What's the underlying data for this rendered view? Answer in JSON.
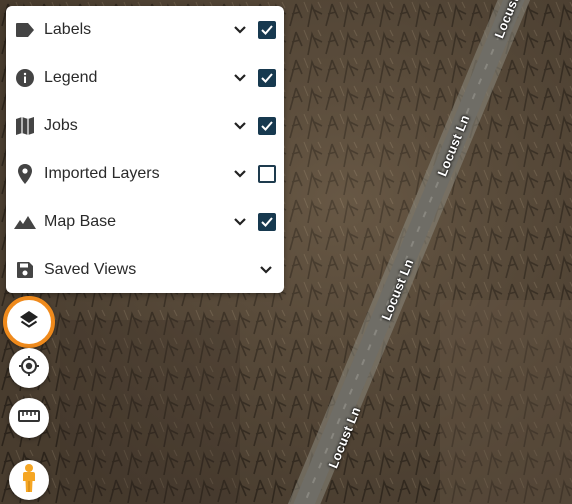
{
  "layers_panel": {
    "items": [
      {
        "label": "Labels",
        "icon": "label-tag-icon",
        "checked": true,
        "has_checkbox": true
      },
      {
        "label": "Legend",
        "icon": "info-icon",
        "checked": true,
        "has_checkbox": true
      },
      {
        "label": "Jobs",
        "icon": "map-icon",
        "checked": true,
        "has_checkbox": true
      },
      {
        "label": "Imported Layers",
        "icon": "location-pin-icon",
        "checked": false,
        "has_checkbox": true
      },
      {
        "label": "Map Base",
        "icon": "terrain-icon",
        "checked": true,
        "has_checkbox": true
      },
      {
        "label": "Saved Views",
        "icon": "floppy-disk-icon",
        "has_checkbox": false
      }
    ]
  },
  "map": {
    "road_labels": [
      "Locust Ln",
      "Locust Ln",
      "Locust Ln",
      "Locust Ln"
    ]
  },
  "tools": [
    {
      "icon": "layers-icon",
      "active": true
    },
    {
      "icon": "crosshair-location-icon",
      "active": false
    },
    {
      "icon": "ruler-icon",
      "active": false
    },
    {
      "icon": "pegman-icon",
      "active": false
    }
  ],
  "colors": {
    "checkbox": "#17394f",
    "active_ring": "#ef8a1c",
    "pegman": "#f5a623"
  }
}
